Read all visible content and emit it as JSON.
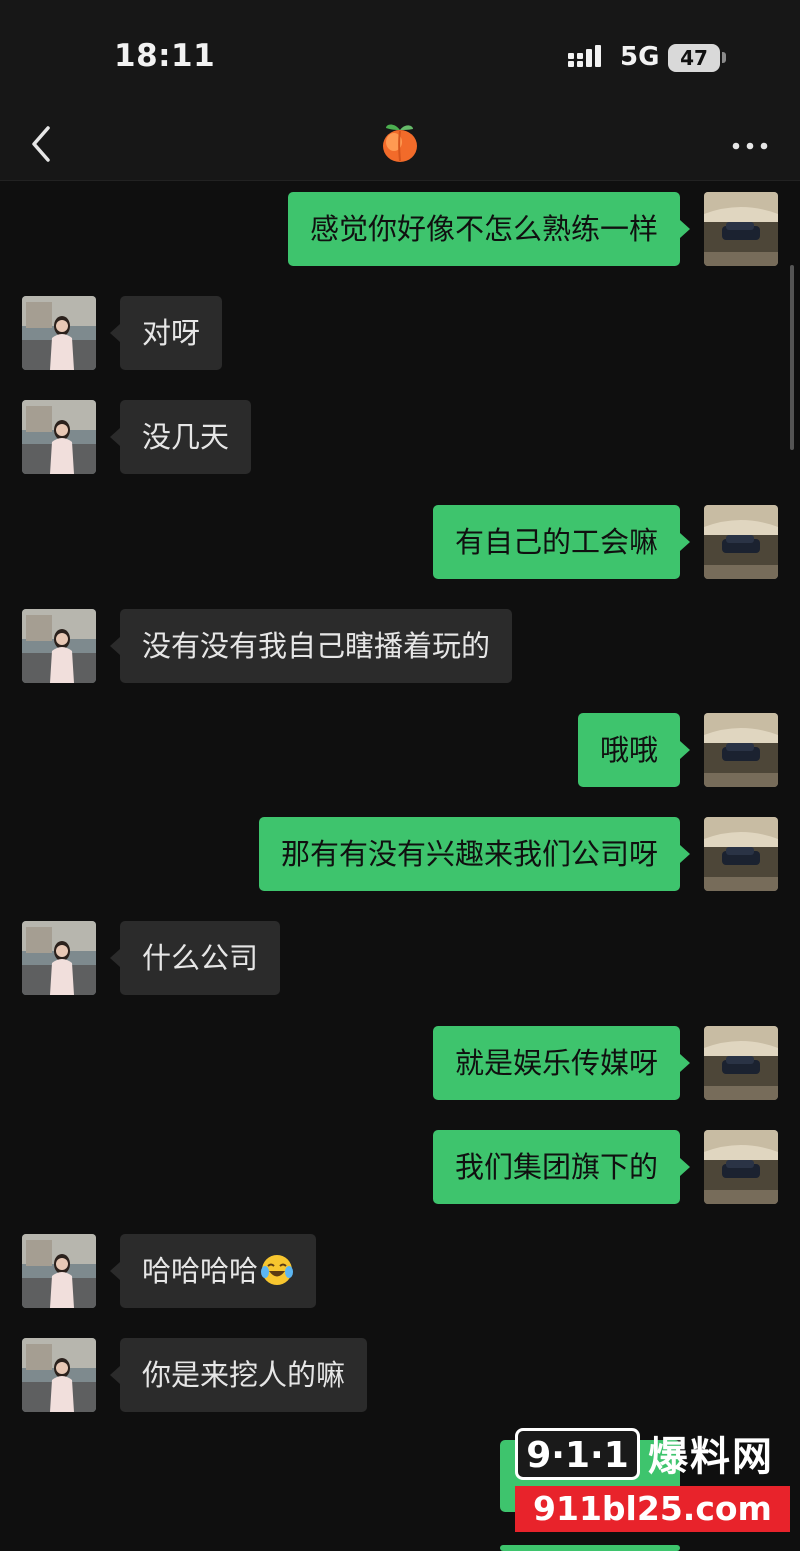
{
  "status_bar": {
    "time": "18:11",
    "network": "5G",
    "battery": "47"
  },
  "nav": {
    "title_icon": "peach-emoji",
    "back_icon": "chevron-left-icon",
    "more_icon": "more-dots-icon"
  },
  "colors": {
    "outgoing_bubble": "#3ec46d",
    "incoming_bubble": "#2b2b2b",
    "background": "#0f0f0f"
  },
  "messages": [
    {
      "side": "out",
      "text": "感觉你好像不怎么熟练一样"
    },
    {
      "side": "in",
      "text": "对呀"
    },
    {
      "side": "in",
      "text": "没几天"
    },
    {
      "side": "out",
      "text": "有自己的工会嘛"
    },
    {
      "side": "in",
      "text": "没有没有我自己瞎播着玩的"
    },
    {
      "side": "out",
      "text": "哦哦"
    },
    {
      "side": "out",
      "text": "那有有没有兴趣来我们公司呀"
    },
    {
      "side": "in",
      "text": "什么公司"
    },
    {
      "side": "out",
      "text": "就是娱乐传媒呀"
    },
    {
      "side": "out",
      "text": "我们集团旗下的"
    },
    {
      "side": "in",
      "text": "哈哈哈哈",
      "emoji": "tears-of-joy-emoji"
    },
    {
      "side": "in",
      "text": "你是来挖人的嘛"
    }
  ],
  "watermark": {
    "logo": "9·1·1",
    "title": "爆料网",
    "url": "911bl25.com"
  }
}
